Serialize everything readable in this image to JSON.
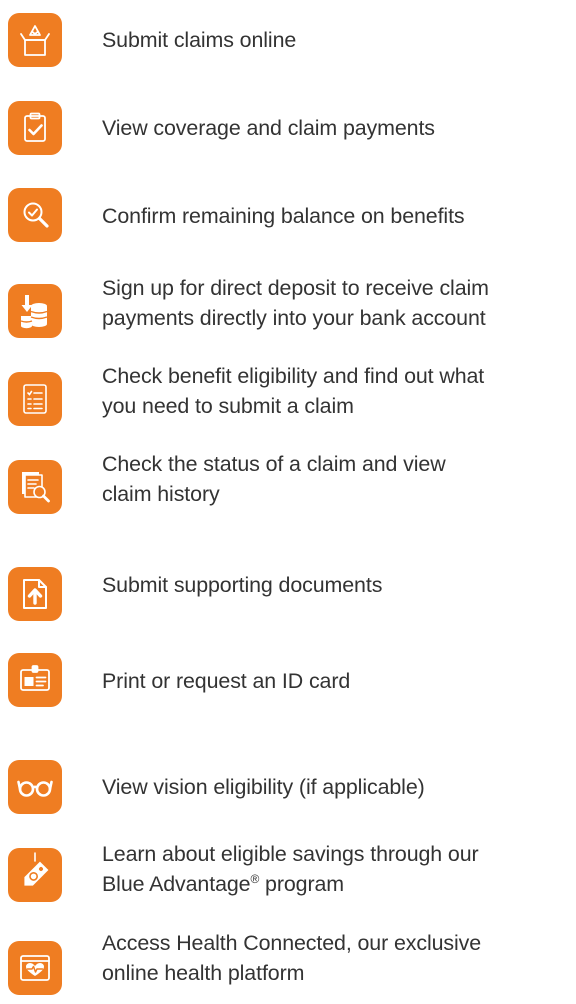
{
  "colors": {
    "accent": "#ef7d22",
    "text": "#333333",
    "icon_stroke": "#ffffff"
  },
  "items": [
    {
      "icon": "open-box-icon",
      "lines": [
        "Submit claims online"
      ]
    },
    {
      "icon": "clipboard-check-icon",
      "lines": [
        "View coverage and claim payments"
      ]
    },
    {
      "icon": "magnifier-check-icon",
      "lines": [
        "Confirm remaining balance on benefits"
      ]
    },
    {
      "icon": "coins-deposit-icon",
      "lines": [
        "Sign up for direct deposit to receive claim",
        "payments directly into your bank account"
      ]
    },
    {
      "icon": "checklist-icon",
      "lines": [
        "Check benefit eligibility and find out what",
        "you need to submit a claim"
      ]
    },
    {
      "icon": "document-search-icon",
      "lines": [
        "Check the status of a claim and view",
        "claim history"
      ]
    },
    {
      "icon": "upload-document-icon",
      "lines": [
        "Submit supporting documents"
      ]
    },
    {
      "icon": "id-card-icon",
      "lines": [
        "Print or request an ID card"
      ]
    },
    {
      "icon": "eyeglasses-icon",
      "lines": [
        "View vision eligibility (if applicable)"
      ]
    },
    {
      "icon": "tag-icon",
      "lines": [
        "Learn about eligible savings through our",
        "Blue Advantage",
        "®",
        " program"
      ]
    },
    {
      "icon": "heart-monitor-icon",
      "lines": [
        "Access Health Connected, our exclusive",
        "online health platform"
      ]
    }
  ]
}
